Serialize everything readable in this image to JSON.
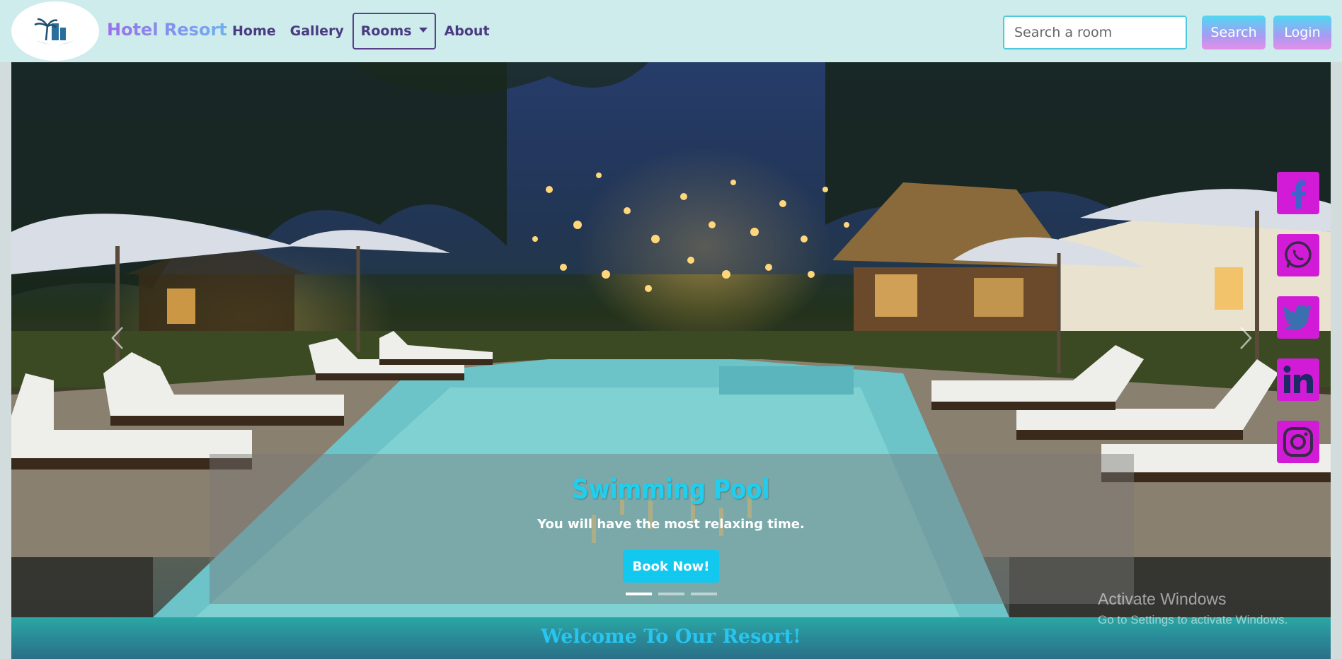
{
  "brand": {
    "name": "Hotel Resort",
    "logo_icon": "palm-hotel-logo-icon"
  },
  "nav": {
    "items": [
      {
        "label": "Home"
      },
      {
        "label": "Gallery"
      },
      {
        "label": "Rooms",
        "has_dropdown": true
      },
      {
        "label": "About"
      }
    ]
  },
  "search": {
    "placeholder": "Search a room",
    "value": "",
    "button_label": "Search"
  },
  "login": {
    "label": "Login"
  },
  "carousel": {
    "caption_title": "Swimming Pool",
    "caption_text": "You will have the most relaxing time.",
    "cta_label": "Book Now!",
    "slide_count": 3,
    "active_index": 0,
    "prev_icon": "chevron-left-icon",
    "next_icon": "chevron-right-icon"
  },
  "social": [
    {
      "name": "facebook-icon"
    },
    {
      "name": "whatsapp-icon"
    },
    {
      "name": "twitter-icon"
    },
    {
      "name": "linkedin-icon"
    },
    {
      "name": "instagram-icon"
    }
  ],
  "welcome": {
    "text": "Welcome To Our Resort!"
  },
  "watermark": {
    "title": "Activate Windows",
    "subtitle": "Go to Settings to activate Windows."
  },
  "colors": {
    "navbar_bg": "#cdeceb",
    "accent_cyan": "#13c8ef",
    "social_magenta": "#d21bd6",
    "nav_text": "#4a3a82"
  }
}
